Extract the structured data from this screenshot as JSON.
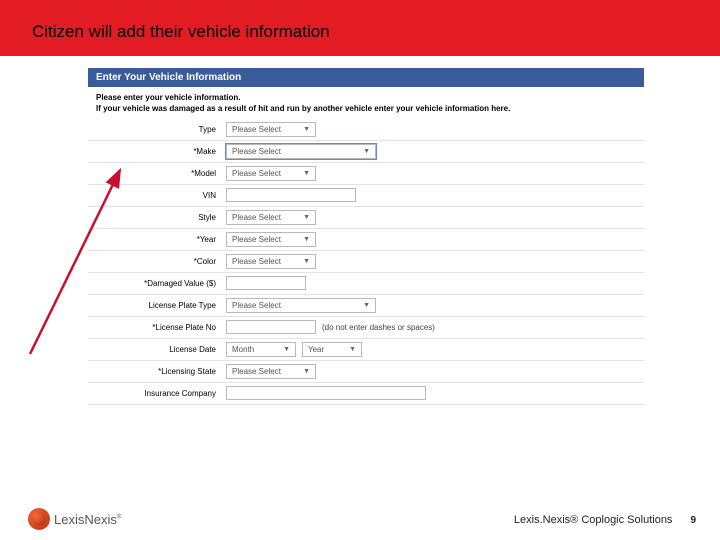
{
  "slide": {
    "title": "Citizen will add their vehicle information",
    "panel_header": "Enter Your Vehicle Information",
    "instruction_line1": "Please enter your vehicle information.",
    "instruction_line2": "If your vehicle was damaged as a result of hit and run by another vehicle enter your vehicle information here.",
    "placeholder": "Please Select",
    "fields": {
      "type": {
        "label": "Type"
      },
      "make": {
        "label": "*Make"
      },
      "model": {
        "label": "*Model"
      },
      "vin": {
        "label": "VIN"
      },
      "style": {
        "label": "Style"
      },
      "year": {
        "label": "*Year"
      },
      "color": {
        "label": "*Color"
      },
      "damaged_value": {
        "label": "*Damaged Value ($)"
      },
      "license_plate_type": {
        "label": "License Plate Type"
      },
      "license_plate_no": {
        "label": "*License Plate No",
        "hint": "(do not enter dashes or spaces)"
      },
      "license_date": {
        "label": "License Date",
        "month": "Month",
        "year": "Year"
      },
      "licensing_state": {
        "label": "*Licensing State"
      },
      "insurance_company": {
        "label": "Insurance Company"
      }
    }
  },
  "footer": {
    "brand_a": "Lexis",
    "brand_b": "Nexis",
    "product": "Lexis.Nexis® Coplogic Solutions",
    "page": "9"
  },
  "colors": {
    "accent_red": "#e31b23",
    "header_blue": "#3b5c9a",
    "arrow_red": "#c8102e"
  }
}
